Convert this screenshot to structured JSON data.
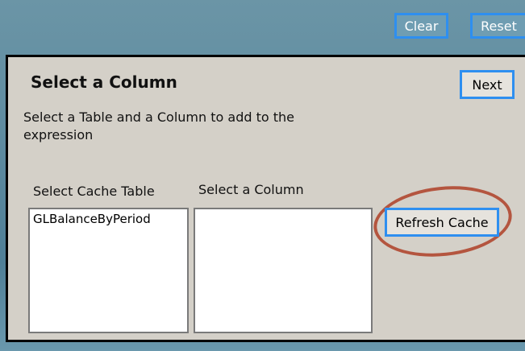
{
  "toolbar": {
    "clear_label": "Clear",
    "reset_label": "Reset"
  },
  "dialog": {
    "title": "Select a Column",
    "next_label": "Next",
    "instructions": "Select a Table and a Column to add to the expression",
    "table_label": "Select Cache Table",
    "column_label": "Select a Column",
    "tables": [
      "GLBalanceByPeriod"
    ],
    "columns": [],
    "refresh_label": "Refresh Cache"
  },
  "colors": {
    "highlight_border": "#2e8ff0",
    "annotation_circle": "#b4553f",
    "dialog_bg": "#d4d0c8"
  }
}
